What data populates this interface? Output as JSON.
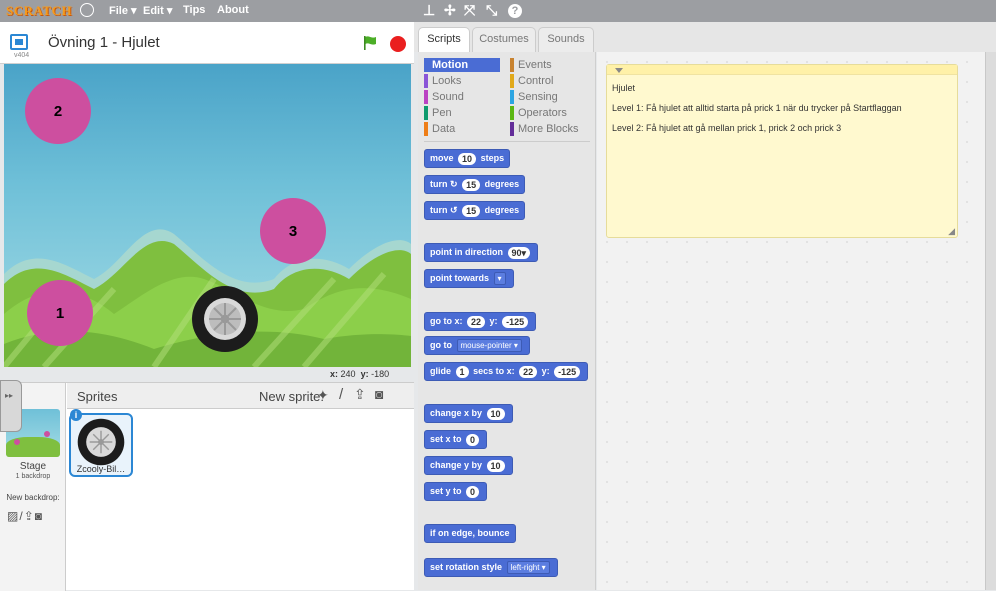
{
  "menubar": {
    "logo": "SCRATCH",
    "file": "File ▾",
    "edit": "Edit ▾",
    "tips": "Tips",
    "about": "About"
  },
  "stage": {
    "version": "v404",
    "title": "Övning 1 - Hjulet",
    "dots": [
      "1",
      "2",
      "3"
    ],
    "coords": {
      "x_label": "x:",
      "x_value": "240",
      "y_label": "y:",
      "y_value": "-180"
    }
  },
  "sprites_panel": {
    "stage_label": "Stage",
    "stage_backdrops": "1 backdrop",
    "new_backdrop": "New backdrop:",
    "sprites_title": "Sprites",
    "new_sprite": "New sprite:",
    "sprite_name": "Zcooly-Bil…"
  },
  "tabs": [
    "Scripts",
    "Costumes",
    "Sounds"
  ],
  "categories": {
    "left": [
      {
        "label": "Motion",
        "color": "#4a6cd4"
      },
      {
        "label": "Looks",
        "color": "#8a55d7"
      },
      {
        "label": "Sound",
        "color": "#bb42c3"
      },
      {
        "label": "Pen",
        "color": "#0e9a6c"
      },
      {
        "label": "Data",
        "color": "#ee7d16"
      }
    ],
    "right": [
      {
        "label": "Events",
        "color": "#c88330"
      },
      {
        "label": "Control",
        "color": "#e1a91a"
      },
      {
        "label": "Sensing",
        "color": "#2ca5e2"
      },
      {
        "label": "Operators",
        "color": "#5cb712"
      },
      {
        "label": "More Blocks",
        "color": "#632d99"
      }
    ]
  },
  "blocks": {
    "move": {
      "a": "move",
      "n": "10",
      "b": "steps"
    },
    "turn_cw": {
      "a": "turn",
      "icon": "↻",
      "n": "15",
      "b": "degrees"
    },
    "turn_ccw": {
      "a": "turn",
      "icon": "↺",
      "n": "15",
      "b": "degrees"
    },
    "point_dir": {
      "a": "point in direction",
      "n": "90▾"
    },
    "point_towards": {
      "a": "point towards",
      "dd": "▾"
    },
    "goto_xy": {
      "a": "go to x:",
      "x": "22",
      "b": "y:",
      "y": "-125"
    },
    "goto": {
      "a": "go to",
      "dd": "mouse-pointer ▾"
    },
    "glide": {
      "a": "glide",
      "n": "1",
      "b": "secs to x:",
      "x": "22",
      "c": "y:",
      "y": "-125"
    },
    "change_x": {
      "a": "change x by",
      "n": "10"
    },
    "set_x": {
      "a": "set x to",
      "n": "0"
    },
    "change_y": {
      "a": "change y by",
      "n": "10"
    },
    "set_y": {
      "a": "set y to",
      "n": "0"
    },
    "bounce": {
      "a": "if on edge, bounce"
    },
    "rotation": {
      "a": "set rotation style",
      "dd": "left-right ▾"
    }
  },
  "comment": {
    "title": "Hjulet",
    "level1": "Level 1: Få hjulet att alltid starta på prick 1 när du trycker på Startflaggan",
    "level2": "Level 2: Få hjulet att gå mellan prick 1, prick 2 och prick 3"
  }
}
